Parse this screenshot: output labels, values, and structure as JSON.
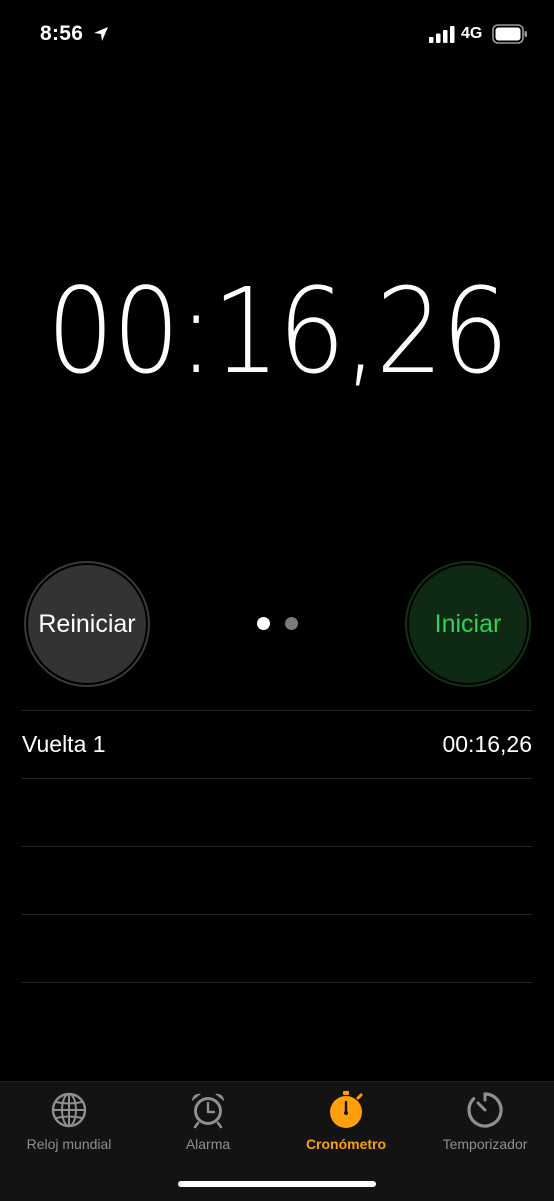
{
  "status_bar": {
    "time": "8:56",
    "network": "4G",
    "icons": [
      "location-arrow-icon",
      "signal-icon",
      "battery-icon"
    ]
  },
  "stopwatch": {
    "time": "00:16,26",
    "reset_label": "Reiniciar",
    "start_label": "Iniciar",
    "page_dots": {
      "count": 2,
      "active": 1
    }
  },
  "laps": [
    {
      "label": "Vuelta 1",
      "time": "00:16,26"
    }
  ],
  "tab_bar": {
    "tabs": [
      {
        "label": "Reloj mundial",
        "icon": "globe-icon",
        "active": false
      },
      {
        "label": "Alarma",
        "icon": "alarm-clock-icon",
        "active": false
      },
      {
        "label": "Cronómetro",
        "icon": "stopwatch-icon",
        "active": true
      },
      {
        "label": "Temporizador",
        "icon": "timer-icon",
        "active": false
      }
    ]
  },
  "colors": {
    "accent": "#ff9f0a",
    "start_text": "#30d158",
    "start_bg": "#0f2a14",
    "reset_bg": "#333335",
    "background": "#000000"
  }
}
